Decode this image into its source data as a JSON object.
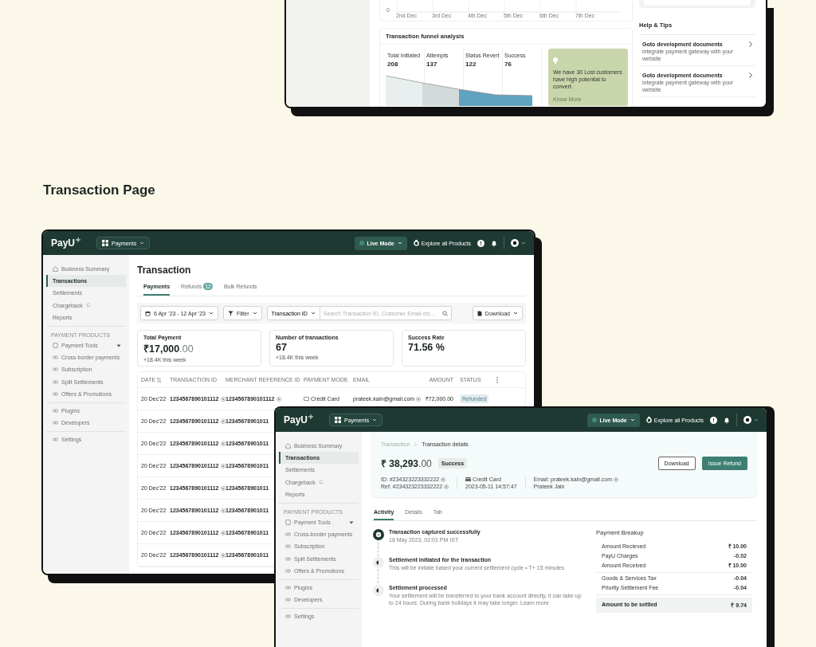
{
  "top_window": {
    "chart": {
      "y_tick": "0",
      "x_labels": [
        "2nd Dec",
        "3rd Dec",
        "4th Dec",
        "5th Dec",
        "6th Dec",
        "7th Dec"
      ]
    },
    "funnel": {
      "title": "Transaction funnel analysis",
      "stages": [
        {
          "label": "Total Initiated",
          "value": "208"
        },
        {
          "label": "Attempts",
          "value": "137"
        },
        {
          "label": "Status Revert",
          "value": "122"
        },
        {
          "label": "Success",
          "value": "76"
        }
      ],
      "insight": {
        "text": "We have 30 Lost customers have high potential to convert.",
        "link": "Know More"
      }
    },
    "help": {
      "title": "Help & Tips",
      "tips": [
        {
          "title": "Goto development documents",
          "description": "integrate payment gateway with your website"
        },
        {
          "title": "Goto development documents",
          "description": "integrate payment gateway with your website"
        }
      ]
    }
  },
  "section_heading": "Transaction Page",
  "list_window": {
    "header": {
      "logo": "PayU",
      "product": "Payments",
      "mode": "Live Mode",
      "explore": "Explore all Products"
    },
    "sidebar": {
      "groups": [
        {
          "items": [
            {
              "label": "Business Summary",
              "kind": "home",
              "selected": false
            },
            {
              "label": "Transactions",
              "kind": "plain",
              "selected": true
            },
            {
              "label": "Settlements",
              "kind": "plain",
              "selected": false
            },
            {
              "label": "Chargeback",
              "kind": "external",
              "selected": false
            },
            {
              "label": "Reports",
              "kind": "plain",
              "selected": false
            }
          ]
        },
        {
          "label": "PAYMENT PRODUCTS",
          "items": [
            {
              "label": "Payment Tools",
              "kind": "menu",
              "selected": false
            },
            {
              "label": "Cross-border payments",
              "kind": "link",
              "selected": false
            },
            {
              "label": "Subscription",
              "kind": "link",
              "selected": false
            },
            {
              "label": "Split Settlements",
              "kind": "link",
              "selected": false
            },
            {
              "label": "Offers & Promotions",
              "kind": "link",
              "selected": false
            }
          ]
        },
        {
          "items": [
            {
              "label": "Plugins",
              "kind": "link",
              "selected": false
            },
            {
              "label": "Developers",
              "kind": "link",
              "selected": false
            }
          ]
        },
        {
          "items": [
            {
              "label": "Settings",
              "kind": "link",
              "selected": false
            }
          ]
        }
      ]
    },
    "title": "Transaction",
    "tabs": [
      {
        "label": "Payments",
        "selected": true
      },
      {
        "label": "Refunds",
        "badge": "12",
        "selected": false
      },
      {
        "label": "Bulk Refunds",
        "selected": false
      }
    ],
    "toolbar": {
      "date_range": "6 Apr '23 - 12 Apr '23",
      "filter": "Filter",
      "search_type": "Transaction ID",
      "search_placeholder": "Search Transaction ID, Customer Email etc...",
      "download": "Download"
    },
    "stats": [
      {
        "label": "Total Payment",
        "value": "₹17,000",
        "decimals": ".00",
        "change": "+18.4K this week"
      },
      {
        "label": "Number of transactions",
        "value": "67",
        "change": "+18.4K this week"
      },
      {
        "label": "Success Rate",
        "value": "71.56 %"
      }
    ],
    "table": {
      "columns": [
        "DATE",
        "TRANSACTION ID",
        "MERCHANT REFERENCE ID",
        "PAYMENT MODE",
        "EMAIL",
        "AMOUNT",
        "STATUS"
      ],
      "rows": [
        {
          "date": "20 Dec'22",
          "transaction_id": "1234567890101112",
          "merchant_ref": "1234567890101112",
          "mode": "Credit Card",
          "email": "prateek.kain@gmail.com",
          "amount": "₹72,000.00",
          "status": "Refunded"
        },
        {
          "date": "20 Dec'22",
          "transaction_id": "1234567890101112",
          "merchant_ref": "12345678901011"
        },
        {
          "date": "20 Dec'22",
          "transaction_id": "1234567890101112",
          "merchant_ref": "12345678901011"
        },
        {
          "date": "20 Dec'22",
          "transaction_id": "1234567890101112",
          "merchant_ref": "12345678901011"
        },
        {
          "date": "20 Dec'22",
          "transaction_id": "1234567890101112",
          "merchant_ref": "12345678901011"
        },
        {
          "date": "20 Dec'22",
          "transaction_id": "1234567890101112",
          "merchant_ref": "12345678901011"
        },
        {
          "date": "20 Dec'22",
          "transaction_id": "1234567890101112",
          "merchant_ref": "12345678901011"
        },
        {
          "date": "20 Dec'22",
          "transaction_id": "1234567890101112",
          "merchant_ref": "12345678901011"
        }
      ]
    }
  },
  "detail_window": {
    "header": {
      "logo": "PayU",
      "product": "Payments",
      "mode": "Live Mode",
      "explore": "Explore all Products"
    },
    "sidebar": {
      "groups": [
        {
          "items": [
            {
              "label": "Business Summary",
              "kind": "home",
              "selected": false
            },
            {
              "label": "Transactions",
              "kind": "plain",
              "selected": true
            },
            {
              "label": "Settlements",
              "kind": "plain",
              "selected": false
            },
            {
              "label": "Chargeback",
              "kind": "external",
              "selected": false
            },
            {
              "label": "Reports",
              "kind": "plain",
              "selected": false
            }
          ]
        },
        {
          "label": "PAYMENT PRODUCTS",
          "items": [
            {
              "label": "Payment Tools",
              "kind": "menu",
              "selected": false
            },
            {
              "label": "Cross-border payments",
              "kind": "link",
              "selected": false
            },
            {
              "label": "Subscription",
              "kind": "link",
              "selected": false
            },
            {
              "label": "Split Settlements",
              "kind": "link",
              "selected": false
            },
            {
              "label": "Offers & Promotions",
              "kind": "link",
              "selected": false
            }
          ]
        },
        {
          "items": [
            {
              "label": "Plugins",
              "kind": "link",
              "selected": false
            },
            {
              "label": "Developers",
              "kind": "link",
              "selected": false
            }
          ]
        },
        {
          "items": [
            {
              "label": "Settings",
              "kind": "link",
              "selected": false
            }
          ]
        }
      ]
    },
    "breadcrumb": [
      "Transaction",
      "Transaction details"
    ],
    "amount": "₹ 38,293",
    "decimals": ".00",
    "status": "Success",
    "buttons": [
      {
        "label": "Download",
        "kind": "secondary"
      },
      {
        "label": "Issue Refund",
        "kind": "primary"
      }
    ],
    "info": [
      {
        "kind": "plain",
        "lines": [
          {
            "text": "ID: #234323223332222",
            "copy": true
          },
          {
            "text": "Ref: #234323223332222",
            "copy": true
          }
        ]
      },
      {
        "kind": "card",
        "lines": [
          {
            "text": "Credit Card",
            "copy": false
          },
          {
            "text": "2023-05-11 14:57:47",
            "copy": false
          }
        ]
      },
      {
        "kind": "plain",
        "lines": [
          {
            "text": "Email: prateek.kain@gmail.com",
            "copy": true
          },
          {
            "text": "Prateek Jain",
            "copy": false
          }
        ]
      }
    ],
    "tabs": [
      {
        "label": "Activity",
        "selected": true
      },
      {
        "label": "Details",
        "selected": false
      },
      {
        "label": "Tab",
        "selected": false
      }
    ],
    "timeline": [
      {
        "kind": "done",
        "title": "Transaction captured successfully",
        "detail": "18 May 2023, 02:01 PM IST"
      },
      {
        "kind": "pending",
        "title": "Settlement initiated for the transaction",
        "detail": "This will be initiate based your current settlement cycle • T+ 15 minutes"
      },
      {
        "kind": "pending",
        "title": "Settlement processed",
        "detail": "Your settlement will be transferred to your bank account directly, it can take up to 24 hours. During bank holidays it may take longer.",
        "link": "Learn more"
      }
    ],
    "breakup": {
      "title": "Payment Breakup",
      "groups": [
        [
          {
            "label": "Amount Recieved",
            "value": "₹ 10.00"
          },
          {
            "label": "PayU Charges",
            "value": "-0.02"
          },
          {
            "label": "Amount Received",
            "value": "₹ 10.00"
          }
        ],
        [
          {
            "label": "Goods & Services Tax",
            "value": "-0.04"
          },
          {
            "label": "Priority Settlement Fee",
            "value": "-0.04"
          }
        ]
      ],
      "total": {
        "label": "Amount to be settled",
        "value": "₹ 9.74"
      }
    }
  }
}
